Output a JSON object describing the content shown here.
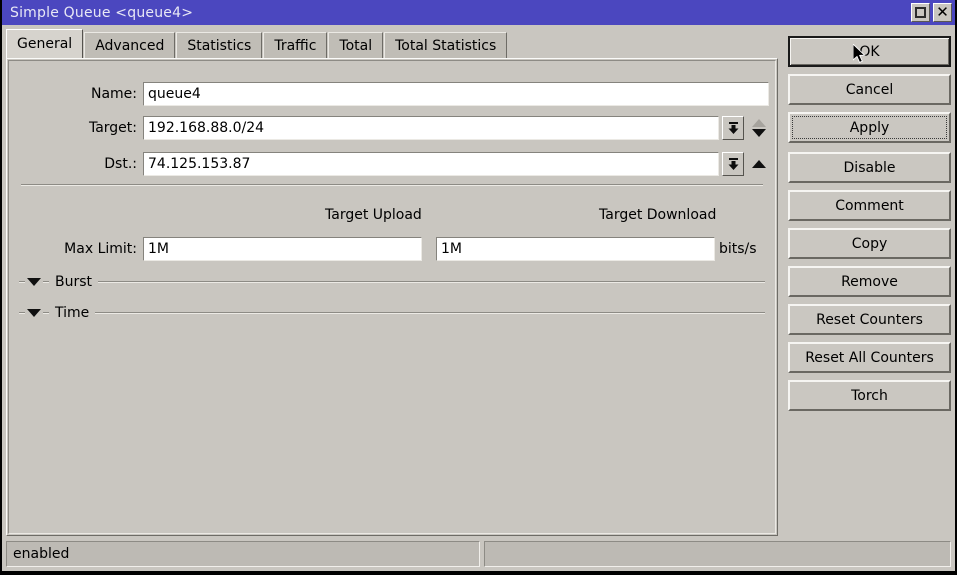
{
  "window": {
    "title": "Simple Queue <queue4>",
    "titlebar_color": "#4b47bf",
    "background_color": "#c9c6c0",
    "controls": [
      {
        "name": "restore-button",
        "label": ""
      },
      {
        "name": "close-button",
        "label": "✕"
      }
    ]
  },
  "tabs": [
    {
      "label": "General",
      "active": true
    },
    {
      "label": "Advanced",
      "active": false
    },
    {
      "label": "Statistics",
      "active": false
    },
    {
      "label": "Traffic",
      "active": false
    },
    {
      "label": "Total",
      "active": false
    },
    {
      "label": "Total Statistics",
      "active": false
    }
  ],
  "form": {
    "name": {
      "label": "Name:",
      "value": "queue4"
    },
    "target": {
      "label": "Target:",
      "value": "192.168.88.0/24"
    },
    "dst": {
      "label": "Dst.:",
      "value": "74.125.153.87"
    },
    "columns": {
      "upload": "Target Upload",
      "download": "Target Download"
    },
    "max_limit": {
      "label": "Max Limit:",
      "upload_value": "1M",
      "download_value": "1M",
      "unit": "bits/s"
    },
    "sections": [
      {
        "label": "Burst",
        "expanded": false
      },
      {
        "label": "Time",
        "expanded": false
      }
    ]
  },
  "buttons": [
    {
      "label": "OK",
      "state": "default"
    },
    {
      "label": "Cancel",
      "state": "normal"
    },
    {
      "label": "Apply",
      "state": "focused"
    },
    {
      "label": "Disable",
      "state": "normal"
    },
    {
      "label": "Comment",
      "state": "normal"
    },
    {
      "label": "Copy",
      "state": "normal"
    },
    {
      "label": "Remove",
      "state": "normal"
    },
    {
      "label": "Reset Counters",
      "state": "normal"
    },
    {
      "label": "Reset All Counters",
      "state": "normal"
    },
    {
      "label": "Torch",
      "state": "normal"
    }
  ],
  "statusbar": {
    "status": "enabled",
    "extra": ""
  },
  "icons": {
    "dropdown": "dropdown-arrow-icon",
    "spinner_up": "triangle-up-icon",
    "spinner_down": "triangle-down-icon",
    "section_toggle": "triangle-down-icon",
    "cursor": "mouse-pointer-icon"
  }
}
